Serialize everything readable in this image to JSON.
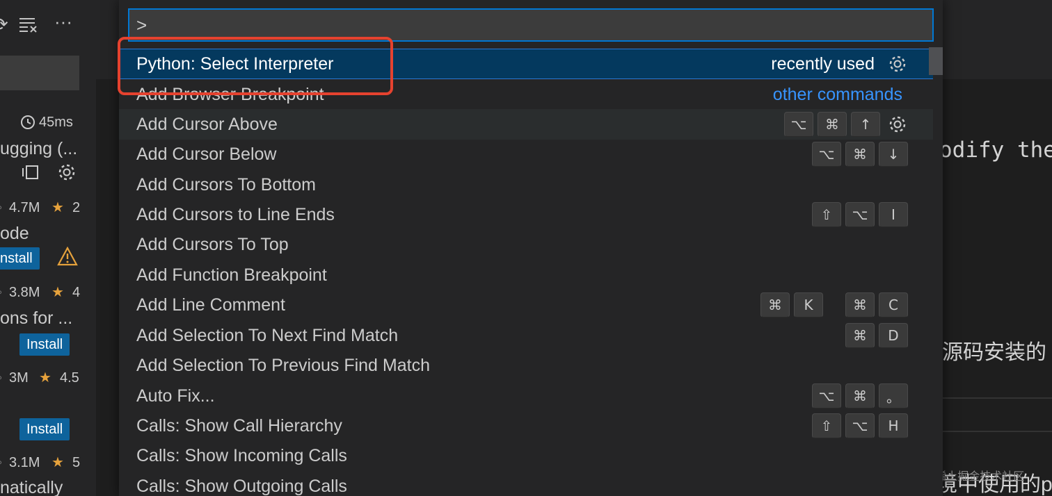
{
  "palette": {
    "input_value": ">",
    "rows": [
      {
        "label": "Python: Select Interpreter",
        "tag": "recently used",
        "keys": [],
        "gear": true
      },
      {
        "label": "Add Browser Breakpoint",
        "tag": "other commands",
        "keys": [],
        "gear": false
      },
      {
        "label": "Add Cursor Above",
        "tag": "",
        "keys": [
          [
            "⌥",
            "⌘",
            "↑"
          ]
        ],
        "gear": true
      },
      {
        "label": "Add Cursor Below",
        "tag": "",
        "keys": [
          [
            "⌥",
            "⌘",
            "↓"
          ]
        ],
        "gear": false
      },
      {
        "label": "Add Cursors To Bottom",
        "tag": "",
        "keys": [],
        "gear": false
      },
      {
        "label": "Add Cursors to Line Ends",
        "tag": "",
        "keys": [
          [
            "⇧",
            "⌥",
            "I"
          ]
        ],
        "gear": false
      },
      {
        "label": "Add Cursors To Top",
        "tag": "",
        "keys": [],
        "gear": false
      },
      {
        "label": "Add Function Breakpoint",
        "tag": "",
        "keys": [],
        "gear": false
      },
      {
        "label": "Add Line Comment",
        "tag": "",
        "keys": [
          [
            "⌘",
            "K"
          ],
          [
            "⌘",
            "C"
          ]
        ],
        "gear": false
      },
      {
        "label": "Add Selection To Next Find Match",
        "tag": "",
        "keys": [
          [
            "⌘",
            "D"
          ]
        ],
        "gear": false
      },
      {
        "label": "Add Selection To Previous Find Match",
        "tag": "",
        "keys": [],
        "gear": false
      },
      {
        "label": "Auto Fix...",
        "tag": "",
        "keys": [
          [
            "⌥",
            "⌘",
            "。"
          ]
        ],
        "gear": false
      },
      {
        "label": "Calls: Show Call Hierarchy",
        "tag": "",
        "keys": [
          [
            "⇧",
            "⌥",
            "H"
          ]
        ],
        "gear": false
      },
      {
        "label": "Calls: Show Incoming Calls",
        "tag": "",
        "keys": [],
        "gear": false
      },
      {
        "label": "Calls: Show Outgoing Calls",
        "tag": "",
        "keys": [],
        "gear": false
      }
    ]
  },
  "sidebar": {
    "duration": "45ms",
    "ext1": {
      "name_fragment": "ugging (...",
      "downloads": "4.7M",
      "rating": "2"
    },
    "ext2": {
      "name_fragment": "ode",
      "install": "nstall",
      "downloads": "3.8M",
      "rating": "4"
    },
    "ext3": {
      "name_fragment": "ons for ...",
      "install": "Install",
      "downloads": "3M",
      "rating": "4.5"
    },
    "ext4": {
      "install": "Install",
      "downloads": "3.1M",
      "rating": "5",
      "name_fragment": "natically"
    }
  },
  "editor": {
    "code_fragment": "odify the",
    "cjk_fragment_1": "源码安装的",
    "cjk_fragment_2": "境中使用的p",
    "watermark": "@稀土掘金技术社区"
  },
  "colors": {
    "selection_bg": "#04395e",
    "accent": "#0078d4",
    "link": "#3794ff",
    "highlight_box": "#e5422f",
    "install_button": "#0e639c",
    "star": "#e6a23c"
  }
}
